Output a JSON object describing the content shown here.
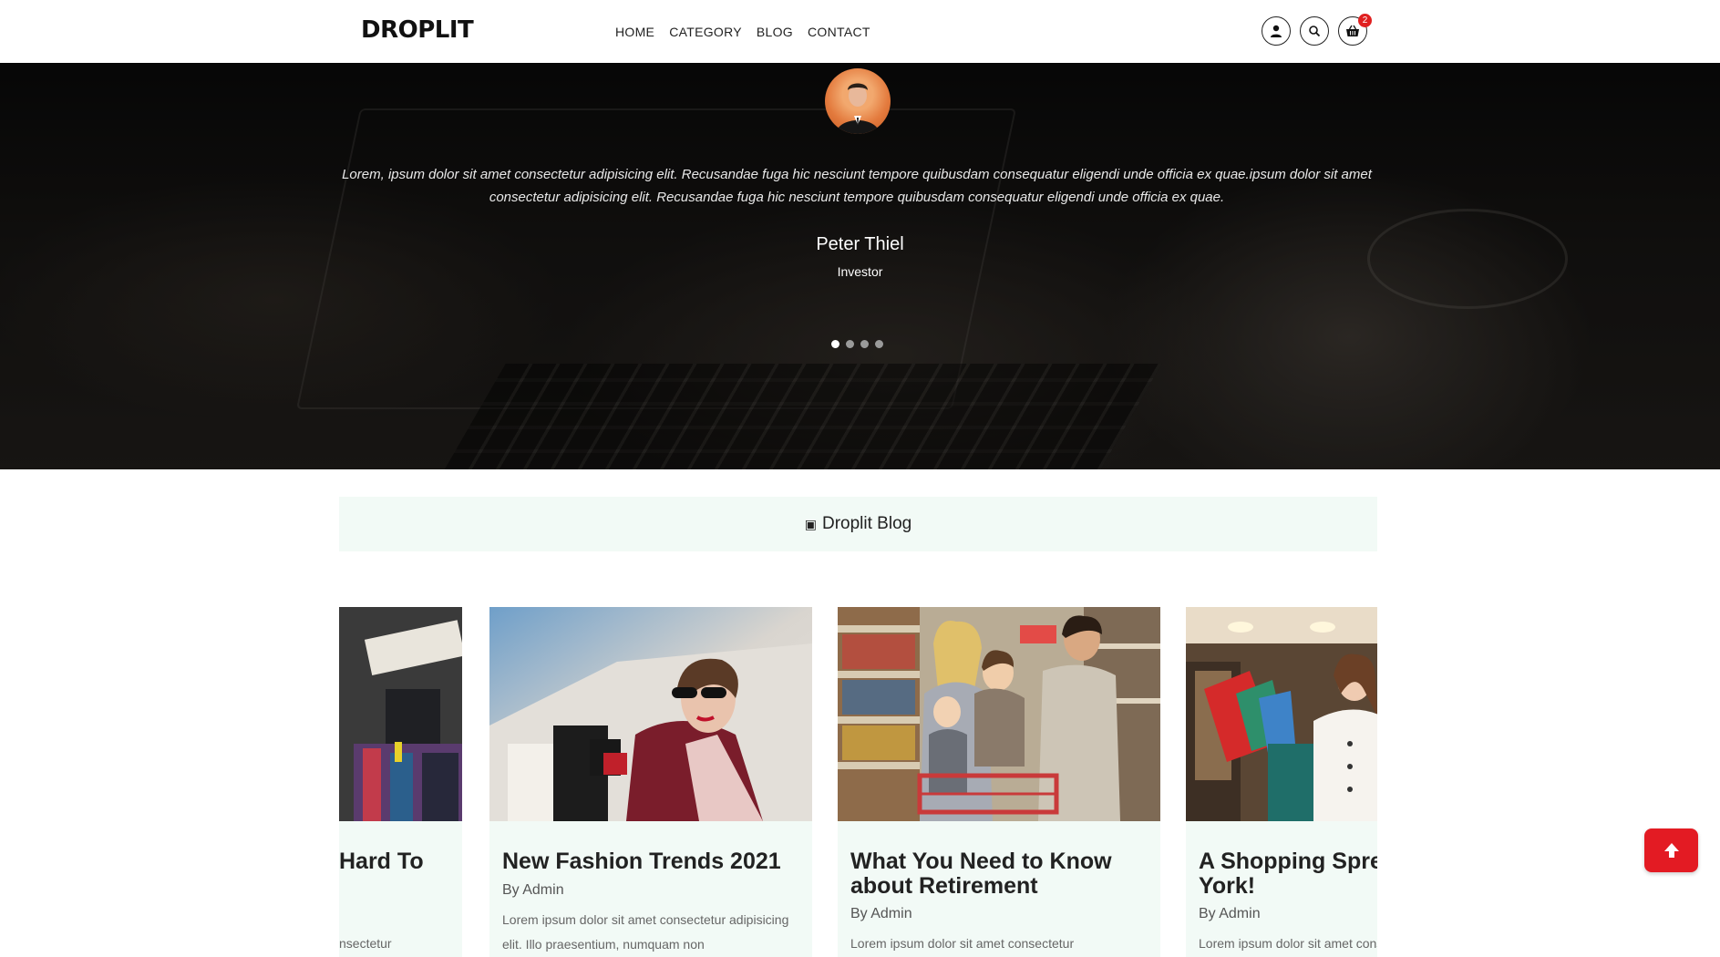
{
  "brand": {
    "logo": "DROPLIT"
  },
  "nav": {
    "items": [
      {
        "label": "HOME"
      },
      {
        "label": "CATEGORY"
      },
      {
        "label": "BLOG"
      },
      {
        "label": "CONTACT"
      }
    ]
  },
  "header_icons": {
    "user": "user-icon",
    "search": "search-icon",
    "cart": "cart-icon",
    "cart_count": "2",
    "badge_color": "#e02020"
  },
  "testimonial": {
    "quote": "Lorem, ipsum dolor sit amet consectetur adipisicing elit. Recusandae fuga hic nesciunt tempore quibusdam consequatur eligendi unde officia ex quae.ipsum dolor sit amet consectetur adipisicing elit. Recusandae fuga hic nesciunt tempore quibusdam consequatur eligendi unde officia ex quae.",
    "name": "Peter Thiel",
    "role": "Investor",
    "slides": 4,
    "active_slide": 1
  },
  "blog": {
    "section_icon": "square-icon",
    "section_title": "Droplit Blog",
    "section_bg": "#f2faf6",
    "posts": [
      {
        "title": "Hard To",
        "author": "",
        "excerpt": "nsectetur"
      },
      {
        "title": "New Fashion Trends 2021",
        "author": "By Admin",
        "excerpt": "Lorem ipsum dolor sit amet consectetur adipisicing elit. Illo praesentium, numquam non"
      },
      {
        "title": "What You Need to Know about Retirement",
        "author": "By Admin",
        "excerpt": "Lorem ipsum dolor sit amet consectetur"
      },
      {
        "title": "A Shopping Spree In New York!",
        "author": "By Admin",
        "excerpt": "Lorem ipsum dolor sit amet consectetur"
      }
    ]
  },
  "back_to_top": {
    "icon": "arrow-up-icon",
    "color": "#e31b23"
  }
}
